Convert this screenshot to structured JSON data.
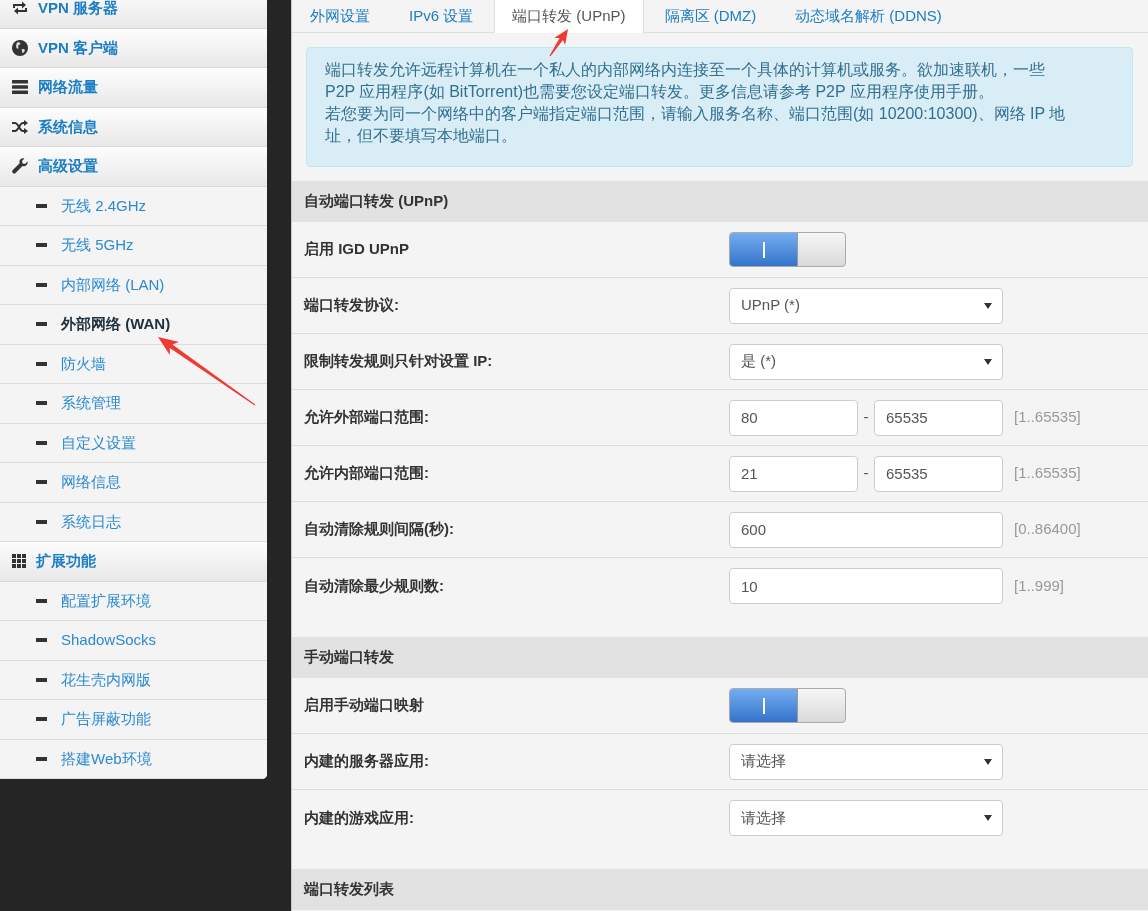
{
  "sidebar": {
    "items": [
      {
        "label": "VPN 服务器",
        "selected": false
      },
      {
        "label": "VPN 客户端",
        "selected": false
      },
      {
        "label": "网络流量",
        "selected": false
      },
      {
        "label": "系统信息",
        "selected": false
      },
      {
        "label": "高级设置",
        "selected": false,
        "children": [
          {
            "label": "无线 2.4GHz",
            "selected": false
          },
          {
            "label": "无线 5GHz",
            "selected": false
          },
          {
            "label": "内部网络 (LAN)",
            "selected": false
          },
          {
            "label": "外部网络 (WAN)",
            "selected": true
          },
          {
            "label": "防火墙",
            "selected": false
          },
          {
            "label": "系统管理",
            "selected": false
          },
          {
            "label": "自定义设置",
            "selected": false
          },
          {
            "label": "网络信息",
            "selected": false
          },
          {
            "label": "系统日志",
            "selected": false
          }
        ]
      },
      {
        "label": "扩展功能",
        "selected": false,
        "children": [
          {
            "label": "配置扩展环境",
            "selected": false
          },
          {
            "label": "ShadowSocks",
            "selected": false
          },
          {
            "label": "花生壳内网版",
            "selected": false
          },
          {
            "label": "广告屏蔽功能",
            "selected": false
          },
          {
            "label": "搭建Web环境",
            "selected": false
          }
        ]
      }
    ]
  },
  "tabs": [
    {
      "label": "外网设置",
      "selected": false
    },
    {
      "label": "IPv6 设置",
      "selected": false
    },
    {
      "label": "端口转发 (UPnP)",
      "selected": true
    },
    {
      "label": "隔离区 (DMZ)",
      "selected": false
    },
    {
      "label": "动态域名解析 (DDNS)",
      "selected": false
    }
  ],
  "notice": {
    "paragraphs": [
      "端口转发允许远程计算机在一个私人的内部网络内连接至一个具体的计算机或服务。欲加速联机，一些 P2P 应用程序(如 BitTorrent)也需要您设定端口转发。更多信息请参考 P2P 应用程序使用手册。",
      "若您要为同一个网络中的客户端指定端口范围，请输入服务名称、端口范围(如 10200:10300)、网络 IP 地址，但不要填写本地端口。"
    ]
  },
  "sections": [
    {
      "title": "自动端口转发 (UPnP)",
      "rows": [
        {
          "kind": "toggle",
          "label": "启用 IGD UPnP",
          "on": true
        },
        {
          "kind": "select",
          "label": "端口转发协议:",
          "value": "UPnP (*)"
        },
        {
          "kind": "select",
          "label": "限制转发规则只针对设置 IP:",
          "value": "是 (*)"
        },
        {
          "kind": "range",
          "label": "允许外部端口范围:",
          "from": "80",
          "separator": "-",
          "to": "65535",
          "hint": "[1..65535]"
        },
        {
          "kind": "range",
          "label": "允许内部端口范围:",
          "from": "21",
          "separator": "-",
          "to": "65535",
          "hint": "[1..65535]"
        },
        {
          "kind": "input",
          "label": "自动清除规则间隔(秒):",
          "value": "600",
          "hint": "[0..86400]"
        },
        {
          "kind": "input",
          "label": "自动清除最少规则数:",
          "value": "10",
          "hint": "[1..999]"
        }
      ]
    },
    {
      "title": "手动端口转发",
      "rows": [
        {
          "kind": "toggle",
          "label": "启用手动端口映射",
          "on": true
        },
        {
          "kind": "select",
          "label": "内建的服务器应用:",
          "value": "请选择"
        },
        {
          "kind": "select",
          "label": "内建的游戏应用:",
          "value": "请选择"
        }
      ]
    },
    {
      "title": "端口转发列表"
    }
  ]
}
